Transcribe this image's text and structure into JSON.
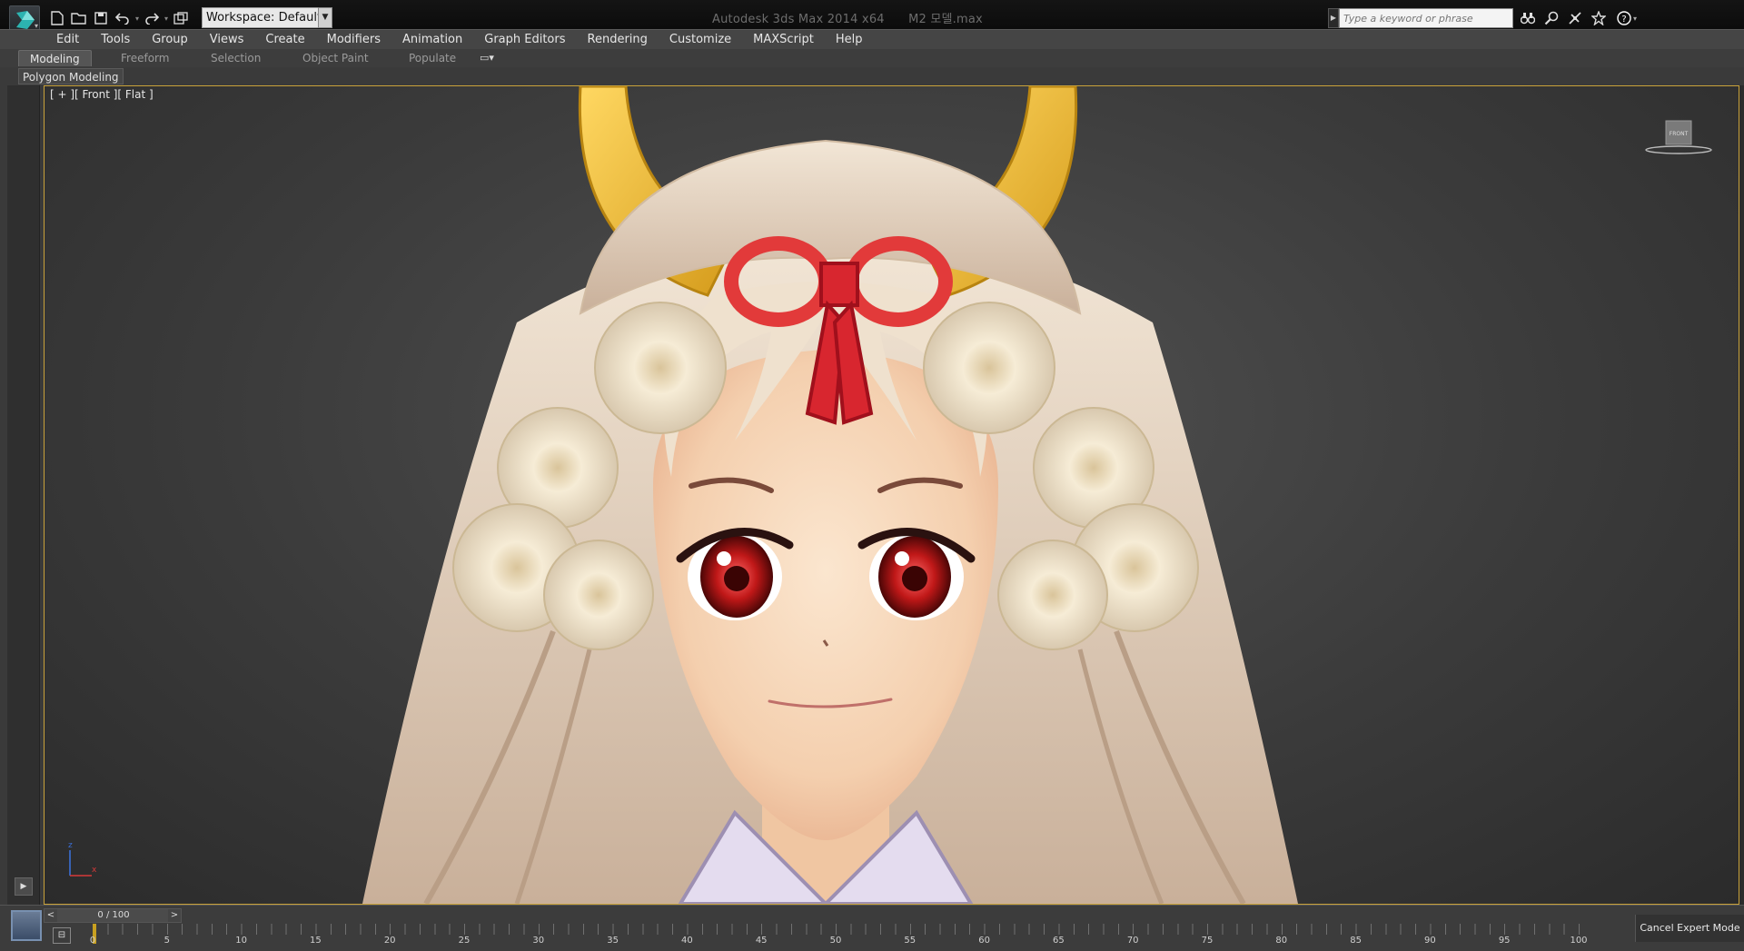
{
  "titlebar": {
    "workspace_label": "Workspace: Default",
    "app_title": "Autodesk 3ds Max  2014 x64",
    "file_name": "M2 모델.max",
    "search_placeholder": "Type a keyword or phrase"
  },
  "menu": {
    "items": [
      "Edit",
      "Tools",
      "Group",
      "Views",
      "Create",
      "Modifiers",
      "Animation",
      "Graph Editors",
      "Rendering",
      "Customize",
      "MAXScript",
      "Help"
    ]
  },
  "ribbon": {
    "tabs": [
      "Modeling",
      "Freeform",
      "Selection",
      "Object Paint",
      "Populate"
    ],
    "active_tab": "Modeling",
    "panel_label": "Polygon Modeling"
  },
  "viewport": {
    "label": "[ + ][ Front ][ Flat ]",
    "viewcube_face": "FRONT",
    "axis_z": "z",
    "axis_x": "x",
    "border_color": "#c9a23a"
  },
  "timeline": {
    "slider_text": "0 / 100",
    "prev": "<",
    "next": ">",
    "tick_labels": [
      "0",
      "5",
      "10",
      "15",
      "20",
      "25",
      "30",
      "35",
      "40",
      "45",
      "50",
      "55",
      "60",
      "65",
      "70",
      "75",
      "80",
      "85",
      "90",
      "95",
      "100"
    ],
    "cancel_expert": "Cancel Expert Mode"
  },
  "icons": [
    "app-logo-icon",
    "new-file-icon",
    "open-file-icon",
    "save-icon",
    "undo-icon",
    "redo-icon",
    "project-folder-icon",
    "binoculars-icon",
    "search-icon",
    "comm-center-icon",
    "favorites-star-icon",
    "help-icon",
    "viewcube-icon",
    "axis-tripod-icon",
    "play-icon",
    "track-bar-icon"
  ]
}
